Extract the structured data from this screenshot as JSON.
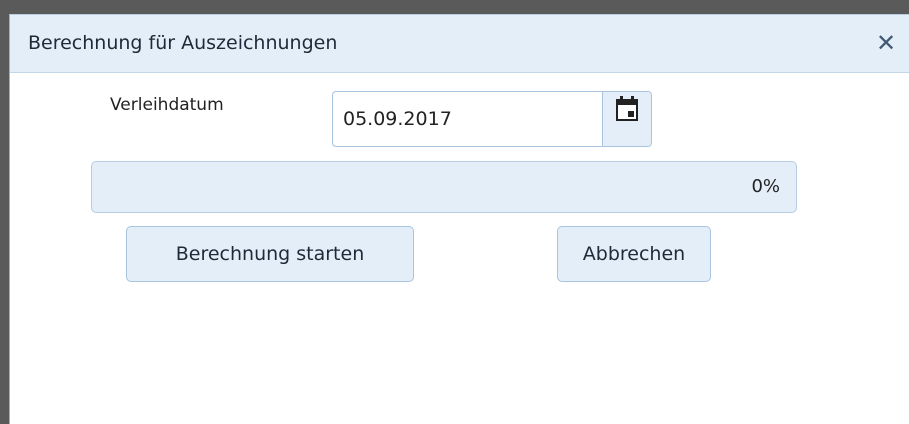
{
  "dialog": {
    "title": "Berechnung für Auszeichnungen",
    "close_icon": "close-icon"
  },
  "form": {
    "date_label": "Verleihdatum",
    "date_value": "05.09.2017",
    "calendar_icon": "calendar-icon"
  },
  "progress": {
    "percent": 0,
    "text": "0%"
  },
  "buttons": {
    "start_label": "Berechnung starten",
    "cancel_label": "Abbrechen"
  },
  "colors": {
    "header_bg": "#e3eef8",
    "border": "#a9c4de",
    "text": "#1e2a38"
  }
}
